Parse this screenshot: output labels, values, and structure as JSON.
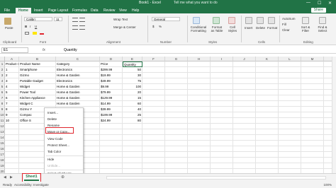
{
  "titlebar": {
    "title": "Book1 - Excel",
    "search": "Tell me what you want to do",
    "min": "—",
    "max": "☐",
    "close": "✕"
  },
  "menu": {
    "file": "File",
    "home": "Home",
    "insert": "Insert",
    "page_layout": "Page Layout",
    "formulas": "Formulas",
    "data": "Data",
    "review": "Review",
    "view": "View",
    "help": "Help",
    "share": "Share"
  },
  "ribbon": {
    "paste": "Paste",
    "clipboard": "Clipboard",
    "font_name": "Calibri",
    "font_size": "11",
    "font_group": "Font",
    "bold": "B",
    "italic": "I",
    "underline": "U",
    "wrap_text": "Wrap Text",
    "merge_center": "Merge & Center",
    "alignment": "Alignment",
    "number_format": "General",
    "number": "Number",
    "conditional_formatting": "Conditional Formatting",
    "format_as_table": "Format as Table",
    "cell_styles": "Cell Styles",
    "styles": "Styles",
    "insert_cells": "Insert",
    "delete_cells": "Delete",
    "format_cells": "Format",
    "cells": "Cells",
    "autosum": "AutoSum",
    "fill": "Fill",
    "clear": "Clear",
    "sort_filter": "Sort & Filter",
    "find_select": "Find & Select",
    "editing": "Editing",
    "dollar": "$",
    "percent": "%"
  },
  "formulabar": {
    "cell_ref": "E1",
    "fx": "fx",
    "content": "Quantity"
  },
  "columns": [
    "A",
    "B",
    "C",
    "D",
    "E",
    "F",
    "G",
    "H",
    "I",
    "J",
    "K",
    "L",
    "M",
    "N"
  ],
  "rows": [
    "1",
    "2",
    "3",
    "4",
    "5",
    "6",
    "7",
    "8",
    "9",
    "10",
    "11",
    "12",
    "13",
    "14",
    "15",
    "16",
    "17",
    "18",
    "19",
    "20",
    "21"
  ],
  "table": {
    "headers": [
      "Product ID",
      "Product Name",
      "Category",
      "Price",
      "Quantity"
    ],
    "rows": [
      [
        "1",
        "Smartphone",
        "Electronics",
        "$299.99",
        "50"
      ],
      [
        "2",
        "Gizmo",
        "Home & Garden",
        "$19.99",
        "30"
      ],
      [
        "3",
        "Portable Gadget",
        "Electronics",
        "$49.99",
        "75"
      ],
      [
        "4",
        "Widget",
        "Home & Garden",
        "$9.99",
        "100"
      ],
      [
        "5",
        "Power Tool",
        "Home & Garden",
        "$79.99",
        "20"
      ],
      [
        "6",
        "Kitchen Appliance",
        "Home & Garden",
        "$129.99",
        "15"
      ],
      [
        "7",
        "Widget C",
        "Home & Garden",
        "$14.99",
        "60"
      ],
      [
        "8",
        "Gizmo Y",
        "Electronics",
        "$39.99",
        "40"
      ],
      [
        "9",
        "Compac",
        "Electronics",
        "$199.99",
        "25"
      ],
      [
        "10",
        "Office S",
        "Electronics",
        "$24.99",
        "80"
      ]
    ]
  },
  "context_menu": {
    "insert": "Insert...",
    "delete": "Delete",
    "rename": "Rename",
    "move_copy": "Move or Copy...",
    "view_code": "View Code",
    "protect_sheet": "Protect Sheet...",
    "tab_color": "Tab Color",
    "hide": "Hide",
    "unhide": "Unhide...",
    "select_all": "Select All Sheets"
  },
  "sheets": {
    "active": "Sheet1",
    "add": "⊕"
  },
  "status": {
    "ready": "Ready",
    "accessibility": "Accessibility: Investigate",
    "zoom": "100%"
  },
  "colors": {
    "excel_green": "#217346",
    "highlight_red": "#e0262e"
  }
}
